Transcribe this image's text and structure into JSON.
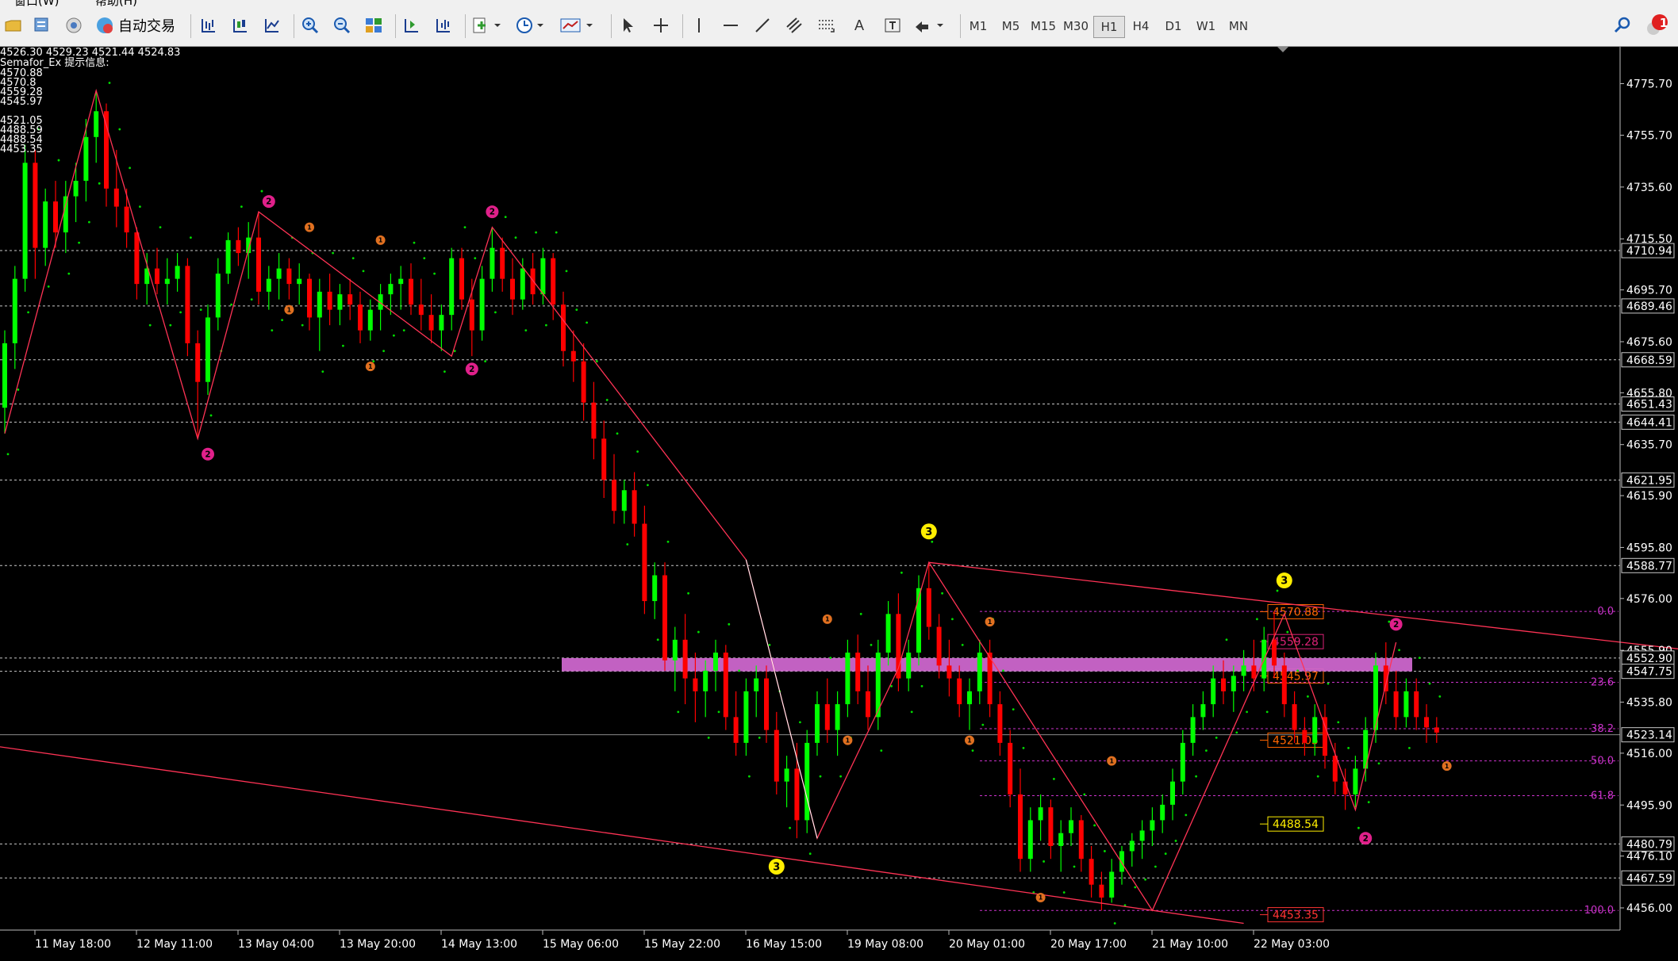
{
  "menu": {
    "window_label": "窗口(W)",
    "help_label": "帮助(H)"
  },
  "toolbar": {
    "autotrade_label": "自动交易",
    "timeframes": [
      "M1",
      "M5",
      "M15",
      "M30",
      "H1",
      "H4",
      "D1",
      "W1",
      "MN"
    ],
    "active_timeframe": "H1",
    "text_tool_label": "A",
    "notification_count": "1",
    "icons": [
      "folder-icon",
      "profiles-icon",
      "market-watch-icon",
      "autotrade-icon",
      "bar-chart-icon",
      "candlestick-icon",
      "line-chart-icon",
      "zoom-in-icon",
      "zoom-out-icon",
      "tile-windows-icon",
      "autoscroll-icon",
      "chart-shift-icon",
      "indicators-icon",
      "periods-icon",
      "templates-icon",
      "cursor-icon",
      "crosshair-icon",
      "vertical-line-icon",
      "horizontal-line-icon",
      "trendline-icon",
      "equidistant-channel-icon",
      "fibonacci-icon",
      "text-icon",
      "text-label-icon",
      "arrows-icon",
      "search-icon",
      "notification-icon"
    ]
  },
  "info_panel": {
    "ohlc": "4526.30 4529.23 4521.44 4524.83",
    "indicator_title": "Semafor_Ex 提示信息:",
    "levels": [
      "4570.88",
      "4570.8",
      "4559.28",
      "4545.97",
      "4521.05",
      "4488.59",
      "4488.54",
      "4453.35"
    ]
  },
  "chart_data": {
    "type": "candlestick",
    "timeframe": "H1",
    "y_axis": {
      "min": 4448,
      "max": 4790,
      "ticks": [
        "4775.70",
        "4755.70",
        "4735.60",
        "4715.50",
        "4695.70",
        "4675.60",
        "4655.80",
        "4635.70",
        "4615.90",
        "4595.80",
        "4576.00",
        "4555.90",
        "4535.80",
        "4516.00",
        "4495.90",
        "4476.10",
        "4456.00"
      ],
      "price_labels": [
        "4710.94",
        "4689.46",
        "4668.59",
        "4651.43",
        "4644.41",
        "4621.95",
        "4588.77",
        "4552.90",
        "4547.75",
        "4523.14",
        "4480.79",
        "4467.59"
      ]
    },
    "x_axis": {
      "labels": [
        "11 May 18:00",
        "12 May 11:00",
        "13 May 04:00",
        "13 May 20:00",
        "14 May 13:00",
        "15 May 06:00",
        "15 May 22:00",
        "16 May 15:00",
        "19 May 08:00",
        "20 May 01:00",
        "20 May 17:00",
        "21 May 10:00",
        "22 May 03:00"
      ]
    },
    "colors": {
      "bull": "#00ff00",
      "bear": "#ff0000",
      "grid": "#c8c8c8",
      "zone": "#cc66cc",
      "fib": "#cc33cc",
      "zigzag": "#ff3355",
      "psar": "#00dd00",
      "semafor1": "#e07020",
      "semafor2": "#e0208a",
      "semafor3": "#ffee00"
    },
    "horizontal_levels": [
      4710.94,
      4689.46,
      4668.59,
      4651.43,
      4644.41,
      4621.95,
      4588.77,
      4552.9,
      4547.75,
      4480.79,
      4467.59
    ],
    "current_price": 4523.14,
    "zone": {
      "from": 4547.75,
      "to": 4552.9
    },
    "fibonacci": {
      "levels": [
        {
          "label": "0.0",
          "price": 4571.0
        },
        {
          "label": "23.6",
          "price": 4543.5
        },
        {
          "label": "38.2",
          "price": 4525.5
        },
        {
          "label": "50.0",
          "price": 4513.0
        },
        {
          "label": "61.8",
          "price": 4499.5
        },
        {
          "label": "100.0",
          "price": 4455.0
        }
      ],
      "value_labels": [
        {
          "text": "4570.88",
          "price": 4570.88,
          "color": "#ff6600"
        },
        {
          "text": "4559.28",
          "price": 4559.28,
          "color": "#dd2277"
        },
        {
          "text": "4545.97",
          "price": 4545.97,
          "color": "#ff6600"
        },
        {
          "text": "4521.05",
          "price": 4521.05,
          "color": "#ff6600"
        },
        {
          "text": "4488.54",
          "price": 4488.54,
          "color": "#ffee00"
        },
        {
          "text": "4453.35",
          "price": 4453.35,
          "color": "#ff3333"
        }
      ]
    },
    "zigzag": [
      [
        0,
        4640
      ],
      [
        9,
        4773
      ],
      [
        19,
        4638
      ],
      [
        25,
        4726
      ],
      [
        44,
        4670
      ],
      [
        48,
        4720
      ],
      [
        73,
        4591
      ],
      [
        80,
        4483
      ],
      [
        88,
        4549
      ],
      [
        91,
        4590
      ],
      [
        113,
        4455
      ],
      [
        126,
        4570
      ],
      [
        133,
        4494
      ],
      [
        137,
        4559
      ]
    ],
    "trendlines": [
      {
        "from": [
          91,
          4590
        ],
        "to": [
          190,
          4545
        ]
      },
      {
        "from": [
          -5,
          4521
        ],
        "to": [
          122,
          4450
        ]
      }
    ],
    "semafor_labels": [
      {
        "text": "2",
        "i": 20,
        "price": 4632,
        "size": 2
      },
      {
        "text": "2",
        "i": 26,
        "price": 4730,
        "size": 2
      },
      {
        "text": "2",
        "i": 48,
        "price": 4726,
        "size": 2
      },
      {
        "text": "2",
        "i": 46,
        "price": 4665,
        "size": 2
      },
      {
        "text": "2",
        "i": 137,
        "price": 4566,
        "size": 2
      },
      {
        "text": "2",
        "i": 134,
        "price": 4483,
        "size": 2
      },
      {
        "text": "3",
        "i": 91,
        "price": 4602,
        "size": 3
      },
      {
        "text": "3",
        "i": 126,
        "price": 4583,
        "size": 3
      },
      {
        "text": "3",
        "i": 76,
        "price": 4472,
        "size": 3
      },
      {
        "text": "1",
        "i": 30,
        "price": 4720,
        "size": 1
      },
      {
        "text": "1",
        "i": 37,
        "price": 4715,
        "size": 1
      },
      {
        "text": "1",
        "i": 28,
        "price": 4688,
        "size": 1
      },
      {
        "text": "1",
        "i": 36,
        "price": 4666,
        "size": 1
      },
      {
        "text": "1",
        "i": 81,
        "price": 4568,
        "size": 1
      },
      {
        "text": "1",
        "i": 97,
        "price": 4567,
        "size": 1
      },
      {
        "text": "1",
        "i": 83,
        "price": 4521,
        "size": 1
      },
      {
        "text": "1",
        "i": 95,
        "price": 4521,
        "size": 1
      },
      {
        "text": "1",
        "i": 109,
        "price": 4513,
        "size": 1
      },
      {
        "text": "1",
        "i": 102,
        "price": 4460,
        "size": 1
      },
      {
        "text": "1",
        "i": 142,
        "price": 4511,
        "size": 1
      }
    ],
    "candles": [
      [
        4650,
        4680,
        4640,
        4675
      ],
      [
        4675,
        4705,
        4665,
        4700
      ],
      [
        4700,
        4752,
        4695,
        4745
      ],
      [
        4745,
        4750,
        4700,
        4712
      ],
      [
        4712,
        4735,
        4705,
        4730
      ],
      [
        4730,
        4738,
        4712,
        4718
      ],
      [
        4718,
        4738,
        4710,
        4732
      ],
      [
        4732,
        4745,
        4722,
        4738
      ],
      [
        4738,
        4762,
        4730,
        4755
      ],
      [
        4755,
        4773,
        4745,
        4765
      ],
      [
        4765,
        4768,
        4728,
        4735
      ],
      [
        4735,
        4750,
        4720,
        4728
      ],
      [
        4728,
        4735,
        4712,
        4718
      ],
      [
        4718,
        4720,
        4692,
        4698
      ],
      [
        4698,
        4710,
        4690,
        4704
      ],
      [
        4704,
        4712,
        4694,
        4698
      ],
      [
        4698,
        4708,
        4690,
        4700
      ],
      [
        4700,
        4710,
        4695,
        4705
      ],
      [
        4705,
        4708,
        4670,
        4675
      ],
      [
        4675,
        4680,
        4638,
        4660
      ],
      [
        4660,
        4690,
        4655,
        4685
      ],
      [
        4685,
        4708,
        4680,
        4702
      ],
      [
        4702,
        4718,
        4698,
        4715
      ],
      [
        4715,
        4720,
        4705,
        4710
      ],
      [
        4710,
        4722,
        4700,
        4716
      ],
      [
        4716,
        4726,
        4690,
        4695
      ],
      [
        4695,
        4705,
        4688,
        4700
      ],
      [
        4700,
        4710,
        4692,
        4704
      ],
      [
        4704,
        4708,
        4692,
        4698
      ],
      [
        4698,
        4706,
        4690,
        4700
      ],
      [
        4700,
        4702,
        4680,
        4685
      ],
      [
        4685,
        4700,
        4672,
        4695
      ],
      [
        4695,
        4702,
        4682,
        4688
      ],
      [
        4688,
        4698,
        4682,
        4694
      ],
      [
        4694,
        4700,
        4684,
        4690
      ],
      [
        4690,
        4695,
        4675,
        4680
      ],
      [
        4680,
        4692,
        4676,
        4688
      ],
      [
        4688,
        4698,
        4680,
        4694
      ],
      [
        4694,
        4702,
        4686,
        4698
      ],
      [
        4698,
        4705,
        4688,
        4700
      ],
      [
        4700,
        4706,
        4686,
        4690
      ],
      [
        4690,
        4700,
        4680,
        4686
      ],
      [
        4686,
        4694,
        4675,
        4680
      ],
      [
        4680,
        4690,
        4672,
        4686
      ],
      [
        4686,
        4712,
        4680,
        4708
      ],
      [
        4708,
        4712,
        4688,
        4692
      ],
      [
        4692,
        4700,
        4670,
        4680
      ],
      [
        4680,
        4705,
        4676,
        4700
      ],
      [
        4700,
        4720,
        4695,
        4712
      ],
      [
        4712,
        4716,
        4695,
        4700
      ],
      [
        4700,
        4708,
        4686,
        4692
      ],
      [
        4692,
        4708,
        4688,
        4704
      ],
      [
        4704,
        4710,
        4690,
        4694
      ],
      [
        4694,
        4712,
        4690,
        4708
      ],
      [
        4708,
        4710,
        4684,
        4690
      ],
      [
        4690,
        4695,
        4666,
        4672
      ],
      [
        4672,
        4680,
        4660,
        4668
      ],
      [
        4668,
        4675,
        4645,
        4652
      ],
      [
        4652,
        4660,
        4630,
        4638
      ],
      [
        4638,
        4645,
        4615,
        4622
      ],
      [
        4622,
        4632,
        4605,
        4610
      ],
      [
        4610,
        4622,
        4605,
        4618
      ],
      [
        4618,
        4625,
        4600,
        4605
      ],
      [
        4605,
        4612,
        4570,
        4575
      ],
      [
        4575,
        4590,
        4568,
        4585
      ],
      [
        4585,
        4590,
        4548,
        4552
      ],
      [
        4552,
        4565,
        4540,
        4560
      ],
      [
        4560,
        4570,
        4535,
        4545
      ],
      [
        4545,
        4555,
        4528,
        4540
      ],
      [
        4540,
        4552,
        4530,
        4548
      ],
      [
        4548,
        4560,
        4540,
        4555
      ],
      [
        4555,
        4558,
        4525,
        4530
      ],
      [
        4530,
        4540,
        4515,
        4520
      ],
      [
        4520,
        4545,
        4515,
        4540
      ],
      [
        4540,
        4550,
        4530,
        4545
      ],
      [
        4545,
        4550,
        4520,
        4525
      ],
      [
        4525,
        4532,
        4500,
        4505
      ],
      [
        4505,
        4515,
        4495,
        4510
      ],
      [
        4510,
        4520,
        4483,
        4490
      ],
      [
        4490,
        4525,
        4485,
        4520
      ],
      [
        4520,
        4540,
        4515,
        4535
      ],
      [
        4535,
        4545,
        4520,
        4525
      ],
      [
        4525,
        4540,
        4515,
        4535
      ],
      [
        4535,
        4560,
        4530,
        4555
      ],
      [
        4555,
        4562,
        4535,
        4540
      ],
      [
        4540,
        4550,
        4525,
        4530
      ],
      [
        4530,
        4560,
        4525,
        4555
      ],
      [
        4555,
        4575,
        4550,
        4570
      ],
      [
        4570,
        4578,
        4540,
        4545
      ],
      [
        4545,
        4560,
        4540,
        4555
      ],
      [
        4555,
        4585,
        4550,
        4580
      ],
      [
        4580,
        4590,
        4560,
        4565
      ],
      [
        4565,
        4570,
        4545,
        4550
      ],
      [
        4550,
        4560,
        4538,
        4545
      ],
      [
        4545,
        4550,
        4530,
        4535
      ],
      [
        4535,
        4545,
        4525,
        4540
      ],
      [
        4540,
        4560,
        4535,
        4555
      ],
      [
        4555,
        4560,
        4530,
        4535
      ],
      [
        4535,
        4540,
        4515,
        4520
      ],
      [
        4520,
        4525,
        4495,
        4500
      ],
      [
        4500,
        4510,
        4470,
        4475
      ],
      [
        4475,
        4495,
        4470,
        4490
      ],
      [
        4490,
        4500,
        4482,
        4495
      ],
      [
        4495,
        4498,
        4475,
        4480
      ],
      [
        4480,
        4490,
        4470,
        4485
      ],
      [
        4485,
        4495,
        4480,
        4490
      ],
      [
        4490,
        4492,
        4470,
        4475
      ],
      [
        4475,
        4480,
        4460,
        4465
      ],
      [
        4465,
        4470,
        4455,
        4460
      ],
      [
        4460,
        4475,
        4458,
        4470
      ],
      [
        4470,
        4480,
        4465,
        4478
      ],
      [
        4478,
        4485,
        4472,
        4482
      ],
      [
        4482,
        4490,
        4475,
        4486
      ],
      [
        4486,
        4495,
        4480,
        4490
      ],
      [
        4490,
        4500,
        4485,
        4496
      ],
      [
        4496,
        4510,
        4490,
        4505
      ],
      [
        4505,
        4525,
        4500,
        4520
      ],
      [
        4520,
        4535,
        4515,
        4530
      ],
      [
        4530,
        4540,
        4525,
        4535
      ],
      [
        4535,
        4550,
        4530,
        4545
      ],
      [
        4545,
        4552,
        4535,
        4540
      ],
      [
        4540,
        4550,
        4532,
        4546
      ],
      [
        4546,
        4556,
        4540,
        4550
      ],
      [
        4550,
        4560,
        4540,
        4545
      ],
      [
        4545,
        4565,
        4540,
        4560
      ],
      [
        4560,
        4571,
        4545,
        4550
      ],
      [
        4550,
        4555,
        4530,
        4535
      ],
      [
        4535,
        4540,
        4520,
        4525
      ],
      [
        4525,
        4530,
        4515,
        4520
      ],
      [
        4520,
        4535,
        4515,
        4530
      ],
      [
        4530,
        4535,
        4510,
        4515
      ],
      [
        4515,
        4520,
        4500,
        4505
      ],
      [
        4505,
        4510,
        4494,
        4500
      ],
      [
        4500,
        4515,
        4495,
        4510
      ],
      [
        4510,
        4530,
        4505,
        4525
      ],
      [
        4525,
        4555,
        4520,
        4550
      ],
      [
        4550,
        4559,
        4535,
        4540
      ],
      [
        4540,
        4548,
        4525,
        4530
      ],
      [
        4530,
        4545,
        4526,
        4540
      ],
      [
        4540,
        4545,
        4525,
        4530
      ],
      [
        4530,
        4535,
        4520,
        4526
      ],
      [
        4526,
        4530,
        4520,
        4524
      ]
    ]
  }
}
